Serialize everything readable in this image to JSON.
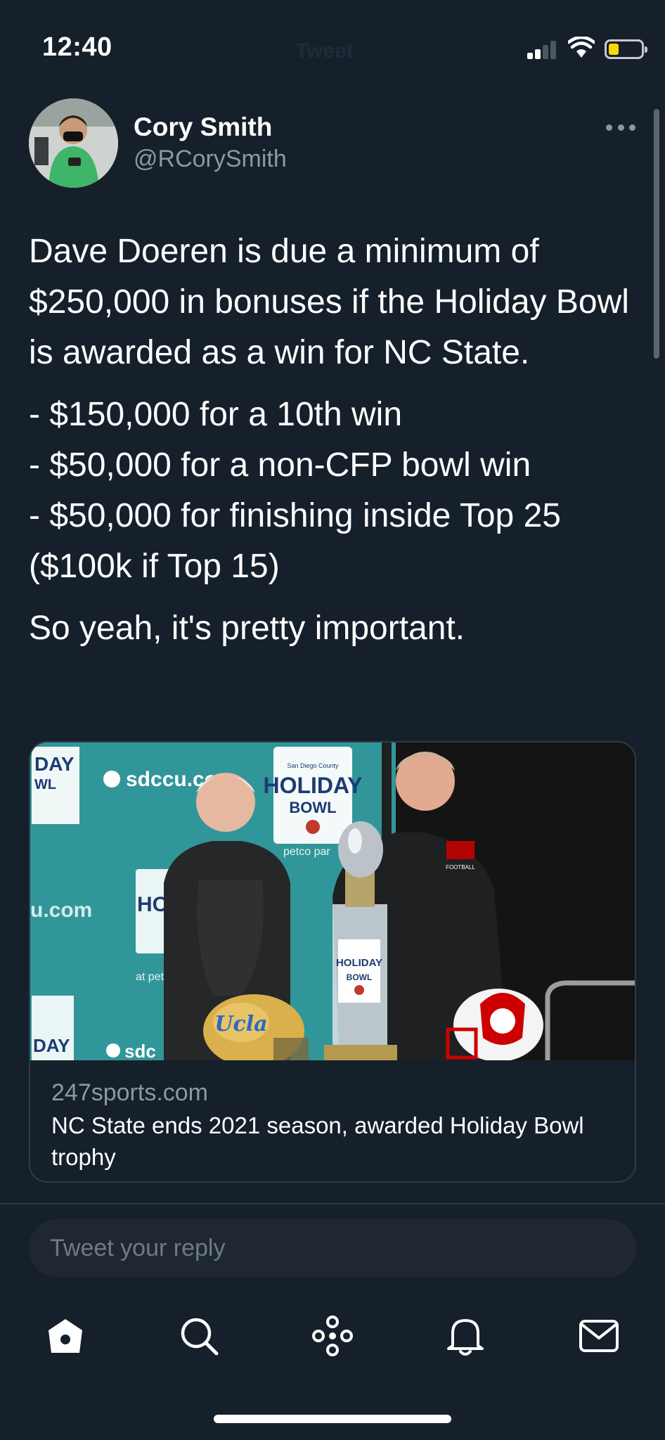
{
  "status_bar": {
    "time": "12:40",
    "ghost_title": "Tweet",
    "battery_color": "#ffd60a"
  },
  "author": {
    "name": "Cory Smith",
    "handle": "@RCorySmith"
  },
  "tweet": {
    "paragraphs": [
      "Dave Doeren is due a minimum of $250,000 in bonuses if the Holiday Bowl is awarded as a win for NC State.",
      "- $150,000 for a 10th win",
      "- $50,000 for a non-CFP bowl win",
      "- $50,000 for finishing inside Top 25 ($100k if Top 15)",
      "So yeah, it's pretty important."
    ]
  },
  "card": {
    "domain": "247sports.com",
    "title": "NC State ends 2021 season, awarded Holiday Bowl trophy",
    "image_banner_text": {
      "sponsor": "sdccu.com",
      "bowl_line1": "HOLIDAY",
      "bowl_line2": "BOWL",
      "credit_union": "San Diego County Credit Union",
      "venue": "at petco park",
      "helmet_text": "Ucla",
      "jersey_text": "FOOTBALL"
    }
  },
  "reply": {
    "placeholder": "Tweet your reply"
  },
  "tab_bar": {
    "items": [
      "home-icon",
      "search-icon",
      "spaces-icon",
      "notifications-icon",
      "messages-icon"
    ]
  },
  "colors": {
    "background": "#15202b",
    "text_primary": "#ffffff",
    "text_secondary": "#8b98a5",
    "border": "#2f3b47",
    "accent_nc_state": "#cc0000",
    "ucla_gold": "#f2a900"
  }
}
